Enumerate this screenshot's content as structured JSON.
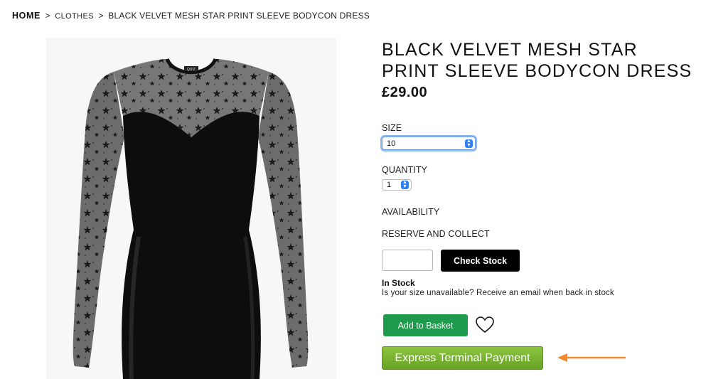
{
  "breadcrumb": {
    "home": "HOME",
    "separator": ">",
    "category": "CLOTHES",
    "current": "BLACK VELVET MESH STAR PRINT SLEEVE BODYCON DRESS"
  },
  "product": {
    "title": "BLACK VELVET MESH STAR PRINT SLEEVE BODYCON DRESS",
    "price": "£29.00",
    "image_label": "QUIZ"
  },
  "options": {
    "size_label": "SIZE",
    "size_value": "10",
    "quantity_label": "QUANTITY",
    "quantity_value": "1",
    "availability_label": "AVAILABILITY",
    "reserve_label": "RESERVE AND COLLECT"
  },
  "stock": {
    "input_value": "",
    "check_button": "Check Stock",
    "status": "In Stock",
    "notify_text": "Is your size unavailable? Receive an email when back in stock"
  },
  "actions": {
    "add_to_basket": "Add to Basket",
    "express_payment": "Express Terminal Payment",
    "wishlist_icon": "heart-outline-icon"
  },
  "colors": {
    "basket_green": "#1e9a4c",
    "express_green": "#76b22f",
    "annotation_arrow": "#f0892a",
    "check_stock_bg": "#000000"
  }
}
